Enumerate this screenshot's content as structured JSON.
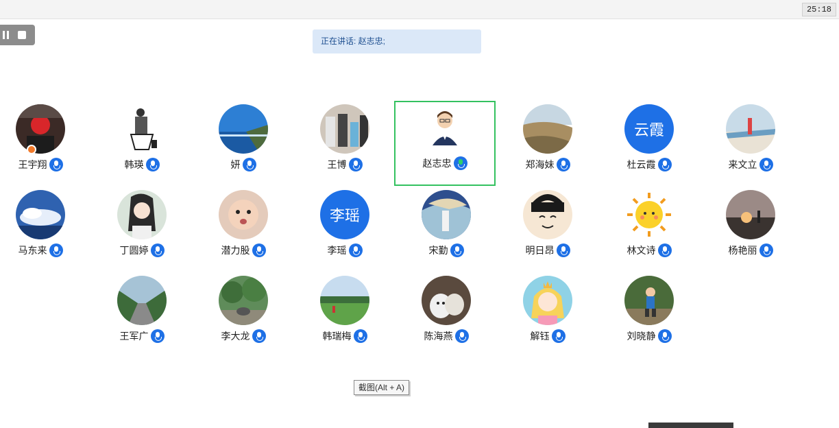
{
  "timer": "25:18",
  "speaking_label": "正在讲话: 赵志忠;",
  "tooltip": "截图(Alt + A)",
  "colors": {
    "accent": "#1e70e6",
    "active_border": "#33c15f",
    "speaking_bg": "#dbe8f8"
  },
  "participants": [
    {
      "name": "王宇翔",
      "avatar": "photo-red-mask",
      "host": true
    },
    {
      "name": "韩瑛",
      "avatar": "sketch-chair"
    },
    {
      "name": "妍",
      "avatar": "photo-ocean"
    },
    {
      "name": "王博",
      "avatar": "photo-family"
    },
    {
      "name": "赵志忠",
      "avatar": "cartoon-man",
      "active": true,
      "talking": true
    },
    {
      "name": "郑海妹",
      "avatar": "photo-desert"
    },
    {
      "name": "杜云霞",
      "avatar": "text",
      "initials": "云霞"
    },
    {
      "name": "来文立",
      "avatar": "photo-beach"
    },
    {
      "name": "马东来",
      "avatar": "photo-sky"
    },
    {
      "name": "丁圆婷",
      "avatar": "illustration-girl"
    },
    {
      "name": "潜力股",
      "avatar": "photo-baby"
    },
    {
      "name": "李瑶",
      "avatar": "text",
      "initials": "李瑶"
    },
    {
      "name": "宋勤",
      "avatar": "illustration-windy"
    },
    {
      "name": "明日昂",
      "avatar": "cartoon-face"
    },
    {
      "name": "林文诗",
      "avatar": "cartoon-sun"
    },
    {
      "name": "杨艳丽",
      "avatar": "photo-sunset"
    },
    {
      "name": "王军广",
      "avatar": "photo-trees-road"
    },
    {
      "name": "李大龙",
      "avatar": "photo-forest"
    },
    {
      "name": "韩瑞梅",
      "avatar": "photo-field"
    },
    {
      "name": "陈海燕",
      "avatar": "photo-cats"
    },
    {
      "name": "解钰",
      "avatar": "cartoon-princess"
    },
    {
      "name": "刘晓静",
      "avatar": "photo-kid"
    }
  ]
}
